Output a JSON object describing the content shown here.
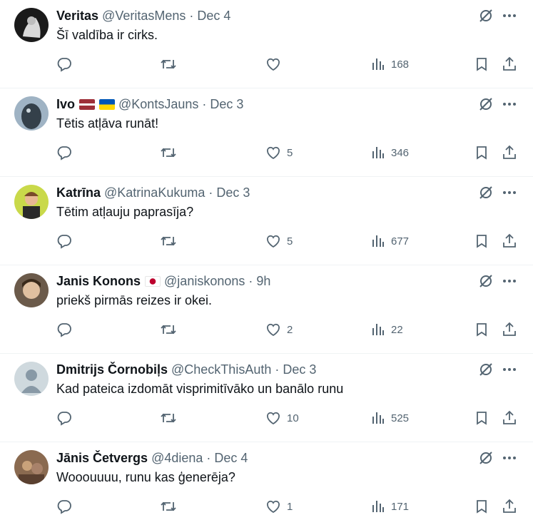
{
  "tweets": [
    {
      "name": "Veritas",
      "flags": [],
      "handle": "@VeritasMens",
      "time": "Dec 4",
      "text": "Šī valdība ir cirks.",
      "likes": "",
      "views": "168",
      "avatar": {
        "bg": "#1a1a1a",
        "fg": "#d9d9d9"
      }
    },
    {
      "name": "Ivo",
      "flags": [
        "latvia",
        "ukraine"
      ],
      "handle": "@KontsJauns",
      "time": "Dec 3",
      "text": "Tētis atļāva runāt!",
      "likes": "5",
      "views": "346",
      "avatar": {
        "bg": "#9fb3c4",
        "fg": "#34404a"
      }
    },
    {
      "name": "Katrīna",
      "flags": [],
      "handle": "@KatrinaKukuma",
      "time": "Dec 3",
      "text": "Tētim atļauju paprasīja?",
      "likes": "5",
      "views": "677",
      "avatar": {
        "bg": "#c9d94a",
        "fg": "#7a4a2a"
      }
    },
    {
      "name": "Janis Konons",
      "flags": [
        "japan"
      ],
      "handle": "@janiskonons",
      "time": "9h",
      "text": "priekš pirmās reizes ir okei.",
      "likes": "2",
      "views": "22",
      "avatar": {
        "bg": "#6b5a4a",
        "fg": "#e0c0a0"
      }
    },
    {
      "name": "Dmitrijs Čornobiļs",
      "flags": [],
      "handle": "@CheckThisAuth",
      "time": "Dec 3",
      "text": "Kad pateica izdomāt visprimitīvāko un banālo runu",
      "likes": "10",
      "views": "525",
      "avatar": {
        "bg": "#cfd9de",
        "fg": "#8899a6"
      }
    },
    {
      "name": "Jānis Četvergs",
      "flags": [],
      "handle": "@4diena",
      "time": "Dec 4",
      "text": "Wooouuuu, runu kas ģenerēja?",
      "likes": "1",
      "views": "171",
      "avatar": {
        "bg": "#8a6a50",
        "fg": "#c9a27a"
      }
    }
  ],
  "separator": "·",
  "icons": [
    "reply-icon",
    "retweet-icon",
    "like-icon",
    "views-icon",
    "bookmark-icon",
    "share-icon",
    "grok-icon",
    "more-icon"
  ],
  "colors": {
    "text": "#0f1419",
    "muted": "#536471",
    "divider": "#eff3f4"
  }
}
